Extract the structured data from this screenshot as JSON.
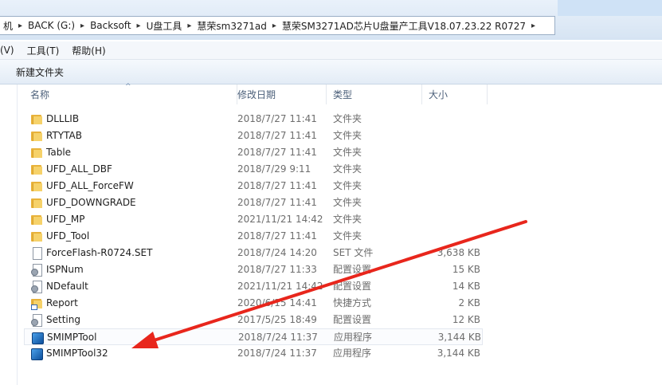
{
  "address": {
    "crumbs": [
      "机",
      "BACK (G:)",
      "Backsoft",
      "U盘工具",
      "慧荣sm3271ad",
      "慧荣SM3271AD芯片U盘量产工具V18.07.23.22 R0727"
    ]
  },
  "menu": {
    "items": [
      "(V)",
      "工具(T)",
      "帮助(H)"
    ]
  },
  "toolbar": {
    "new_folder": "新建文件夹"
  },
  "columns": {
    "name": "名称",
    "date": "修改日期",
    "type": "类型",
    "size": "大小"
  },
  "files": [
    {
      "name": "DLLLIB",
      "date": "2018/7/27 11:41",
      "type": "文件夹",
      "size": "",
      "icon": "folder-icon"
    },
    {
      "name": "RTYTAB",
      "date": "2018/7/27 11:41",
      "type": "文件夹",
      "size": "",
      "icon": "folder-icon"
    },
    {
      "name": "Table",
      "date": "2018/7/27 11:41",
      "type": "文件夹",
      "size": "",
      "icon": "folder-icon"
    },
    {
      "name": "UFD_ALL_DBF",
      "date": "2018/7/29 9:11",
      "type": "文件夹",
      "size": "",
      "icon": "folder-icon"
    },
    {
      "name": "UFD_ALL_ForceFW",
      "date": "2018/7/27 11:41",
      "type": "文件夹",
      "size": "",
      "icon": "folder-icon"
    },
    {
      "name": "UFD_DOWNGRADE",
      "date": "2018/7/27 11:41",
      "type": "文件夹",
      "size": "",
      "icon": "folder-icon"
    },
    {
      "name": "UFD_MP",
      "date": "2021/11/21 14:42",
      "type": "文件夹",
      "size": "",
      "icon": "folder-icon"
    },
    {
      "name": "UFD_Tool",
      "date": "2018/7/27 11:41",
      "type": "文件夹",
      "size": "",
      "icon": "folder-icon"
    },
    {
      "name": "ForceFlash-R0724.SET",
      "date": "2018/7/24 14:20",
      "type": "SET 文件",
      "size": "3,638 KB",
      "icon": "file-icon"
    },
    {
      "name": "ISPNum",
      "date": "2018/7/27 11:33",
      "type": "配置设置",
      "size": "15 KB",
      "icon": "settings-file-icon"
    },
    {
      "name": "NDefault",
      "date": "2021/11/21 14:42",
      "type": "配置设置",
      "size": "14 KB",
      "icon": "settings-file-icon"
    },
    {
      "name": "Report",
      "date": "2020/6/15 14:41",
      "type": "快捷方式",
      "size": "2 KB",
      "icon": "shortcut-folder-icon"
    },
    {
      "name": "Setting",
      "date": "2017/5/25 18:49",
      "type": "配置设置",
      "size": "12 KB",
      "icon": "settings-file-icon"
    },
    {
      "name": "SMIMPTool",
      "date": "2018/7/24 11:37",
      "type": "应用程序",
      "size": "3,144 KB",
      "icon": "application-icon"
    },
    {
      "name": "SMIMPTool32",
      "date": "2018/7/24 11:37",
      "type": "应用程序",
      "size": "3,144 KB",
      "icon": "application-icon"
    }
  ],
  "selected_row": 13,
  "colors": {
    "annotation_arrow": "#e8261c"
  }
}
